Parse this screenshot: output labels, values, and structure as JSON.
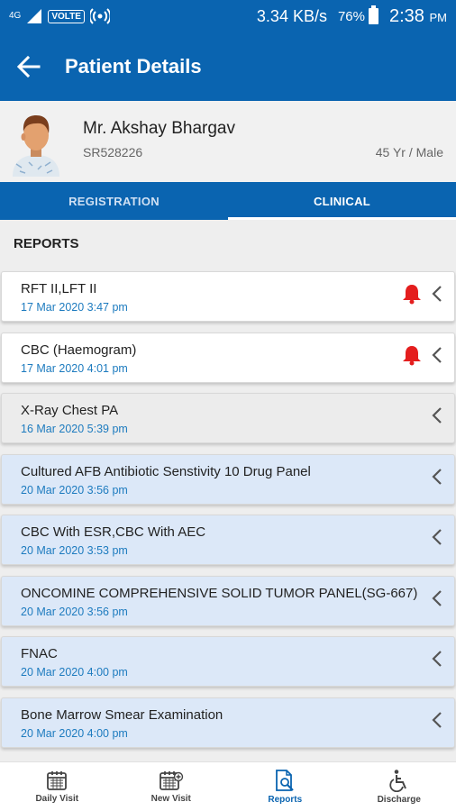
{
  "status_bar": {
    "network": "4G",
    "volte": "VOLTE",
    "speed": "3.34 KB/s",
    "battery": "76%",
    "time": "2:38",
    "ampm": "PM"
  },
  "header": {
    "title": "Patient Details"
  },
  "patient": {
    "name": "Mr. Akshay Bhargav",
    "id": "SR528226",
    "age": "45 Yr",
    "gender_sep": " / ",
    "gender": "Male"
  },
  "tabs": [
    {
      "label": "REGISTRATION",
      "active": false
    },
    {
      "label": "CLINICAL",
      "active": true
    }
  ],
  "reports": {
    "title": "REPORTS",
    "items": [
      {
        "name": "RFT II,LFT II",
        "date": "17 Mar 2020 3:47 pm",
        "alert": true,
        "style": "white"
      },
      {
        "name": "CBC (Haemogram)",
        "date": "17 Mar 2020 4:01 pm",
        "alert": true,
        "style": "white"
      },
      {
        "name": "X-Ray Chest PA",
        "date": "16 Mar 2020 5:39 pm",
        "alert": false,
        "style": "gray"
      },
      {
        "name": "Cultured AFB Antibiotic Senstivity 10 Drug Panel",
        "date": "20 Mar 2020 3:56 pm",
        "alert": false,
        "style": "blue"
      },
      {
        "name": "CBC With ESR,CBC With AEC",
        "date": "20 Mar 2020 3:53 pm",
        "alert": false,
        "style": "blue"
      },
      {
        "name": "ONCOMINE COMPREHENSIVE SOLID TUMOR PANEL(SG-667)",
        "date": "20 Mar 2020 3:56 pm",
        "alert": false,
        "style": "blue"
      },
      {
        "name": "FNAC",
        "date": "20 Mar 2020 4:00 pm",
        "alert": false,
        "style": "blue"
      },
      {
        "name": "Bone Marrow Smear Examination",
        "date": "20 Mar 2020 4:00 pm",
        "alert": false,
        "style": "blue"
      }
    ]
  },
  "bottom_nav": [
    {
      "label": "Daily Visit",
      "icon": "calendar-icon",
      "active": false
    },
    {
      "label": "New Visit",
      "icon": "calendar-add-icon",
      "active": false
    },
    {
      "label": "Reports",
      "icon": "report-search-icon",
      "active": true
    },
    {
      "label": "Discharge",
      "icon": "wheelchair-icon",
      "active": false
    }
  ],
  "colors": {
    "primary": "#0a64b0",
    "date": "#1d7bbf",
    "alert": "#e41e1e"
  }
}
